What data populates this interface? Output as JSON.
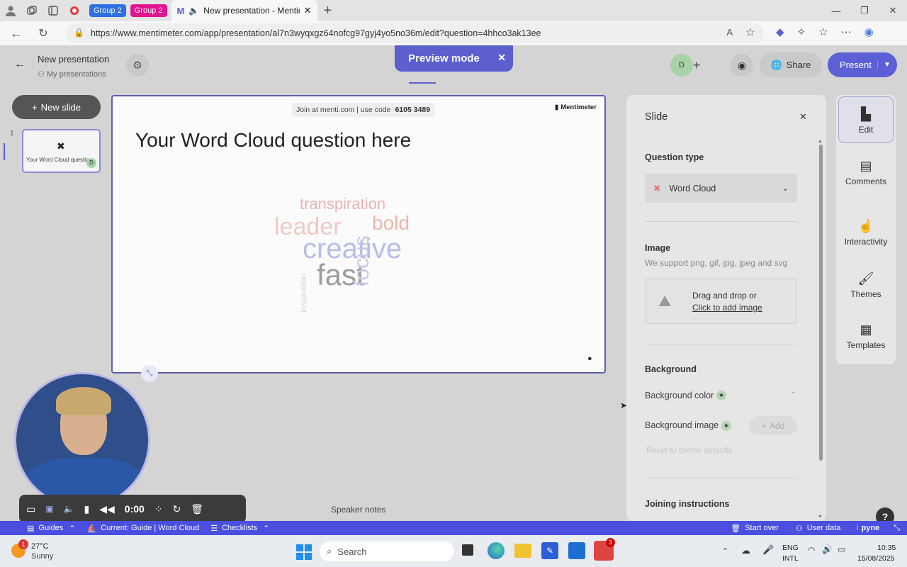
{
  "browser": {
    "group1": "Group 2",
    "group2": "Group 2",
    "tab_title": "New presentation - Mentime",
    "url": "https://www.mentimeter.com/app/presentation/al7n3wyqxgz64nofcg97gyj4yo5no36m/edit?question=4hhco3ak13ee"
  },
  "header": {
    "title": "New presentation",
    "breadcrumb": "My presentations",
    "preview_mode": "Preview mode",
    "avatar_initial": "D",
    "share": "Share",
    "present": "Present"
  },
  "left": {
    "new_slide": "New slide",
    "slide_number": "1",
    "thumb_label": "Your Word Cloud questio",
    "thumb_badge": "D"
  },
  "slide": {
    "join_text": "Join at menti.com | use code",
    "code": "6105 3489",
    "brand": "Mentimeter",
    "question": "Your Word Cloud question here",
    "words": [
      {
        "text": "transpiration",
        "color": "#e8b4b0"
      },
      {
        "text": "leader",
        "color": "#f0c8c4"
      },
      {
        "text": "bold",
        "color": "#eab7a8"
      },
      {
        "text": "creative",
        "color": "#b7bde8"
      },
      {
        "text": "fast",
        "color": "#9b9b9b"
      },
      {
        "text": "focus",
        "color": "#c9c9e8"
      },
      {
        "text": "inspiration",
        "color": "#d3d3e6"
      }
    ]
  },
  "speaker_notes": "Speaker notes",
  "panel": {
    "title": "Slide",
    "question_type_label": "Question type",
    "question_type_value": "Word Cloud",
    "image_label": "Image",
    "image_support": "We support png, gif, jpg, jpeg and svg",
    "drag_drop": "Drag and drop or",
    "click_add": "Click to add image",
    "background_label": "Background",
    "bg_color": "Background color",
    "bg_image": "Background image",
    "add": "Add",
    "reset": "Reset to theme defaults",
    "joining": "Joining instructions"
  },
  "rail": {
    "edit": "Edit",
    "comments": "Comments",
    "interactivity": "Interactivity",
    "themes": "Themes",
    "templates": "Templates"
  },
  "recorder": {
    "time": "0:00"
  },
  "guidebar": {
    "guides": "Guides",
    "current": "Current: Guide | Word Cloud",
    "checklists": "Checklists",
    "start_over": "Start over",
    "user_data": "User data",
    "brand": "pyne"
  },
  "taskbar": {
    "weather_temp": "27°C",
    "weather_desc": "Sunny",
    "weather_badge": "1",
    "search": "Search",
    "lang1": "ENG",
    "lang2": "INTL",
    "time": "10:35",
    "date": "15/08/2025",
    "teams_badge": "3"
  },
  "colors": {
    "accent": "#5c5fd6",
    "guidebar": "#4a4fe0",
    "group1": "#2f6fe0",
    "group2": "#e0148f"
  }
}
